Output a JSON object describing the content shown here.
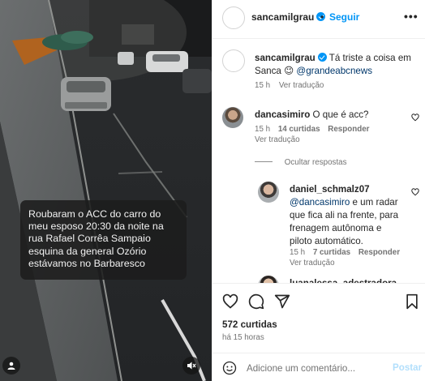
{
  "post": {
    "author": "sancamilgrau",
    "follow_label": "Seguir",
    "separator": "•",
    "more_label": "•••"
  },
  "caption": {
    "username": "sancamilgrau",
    "text": "Tá triste a coisa em Sanca 😉",
    "mention": "@grandeabcnews",
    "time": "15 h",
    "translate_label": "Ver tradução"
  },
  "comments": [
    {
      "username": "dancasimiro",
      "text": "O que é acc?",
      "time": "15 h",
      "likes": "14 curtidas",
      "reply_label": "Responder",
      "translate_label": "Ver tradução"
    }
  ],
  "hide_replies_label": "Ocultar respostas",
  "replies": [
    {
      "username": "daniel_schmalz07",
      "mention": "@dancasimiro",
      "text_line1": "e um radar",
      "text_line2": "que fica ali na frente, para",
      "text_line3": "frenagem autônoma e",
      "text_line4": "piloto automático.",
      "time": "15 h",
      "likes": "7 curtidas",
      "reply_label": "Responder",
      "translate_label": "Ver tradução"
    },
    {
      "username": "luanalessa_adestradora"
    }
  ],
  "video": {
    "overlay_text": "Roubaram o ACC do carro do\nmeu esposo 20:30 da noite na\nrua Rafael Corrêa Sampaio\nesquina da general Ozório\nestávamos no Barbaresco"
  },
  "footer": {
    "likes": "572 curtidas",
    "time_ago": "há 15 horas",
    "comment_placeholder": "Adicione um comentário...",
    "post_label": "Postar"
  },
  "icons": {
    "like": "heart-icon",
    "comment": "comment-icon",
    "share": "share-icon",
    "save": "bookmark-icon",
    "emoji": "smiley-icon",
    "mute": "speaker-muted-icon",
    "tag": "user-tag-icon"
  },
  "colors": {
    "link": "#0095f6",
    "mention": "#00376b",
    "muted_text": "#737373",
    "post_disabled": "#b2dffc"
  }
}
